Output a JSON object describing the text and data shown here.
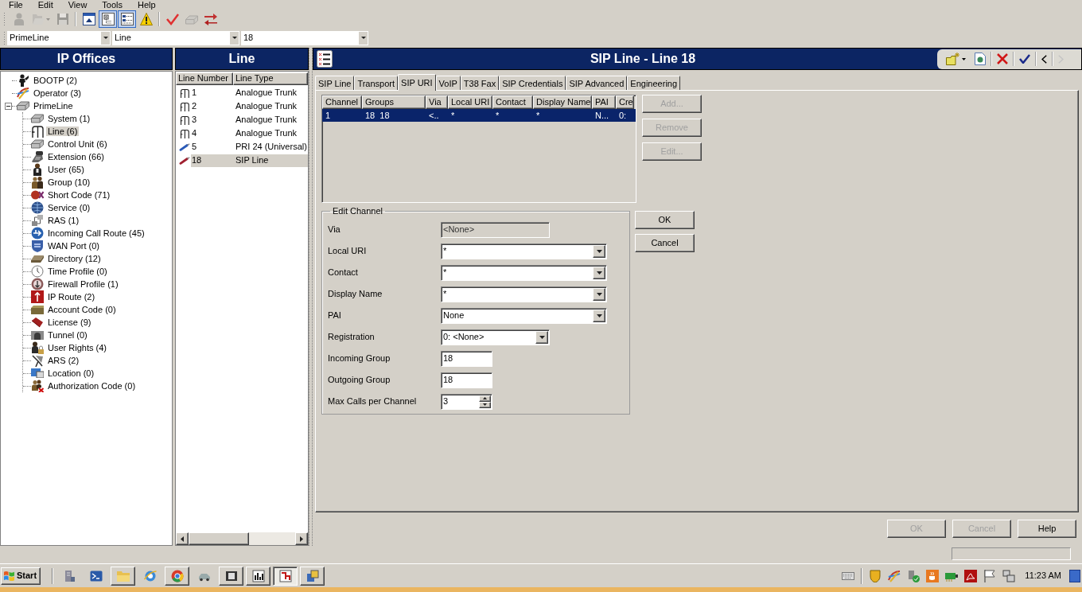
{
  "menu_bar": [
    {
      "label": "File"
    },
    {
      "label": "Edit"
    },
    {
      "label": "View"
    },
    {
      "label": "Tools"
    },
    {
      "label": "Help"
    }
  ],
  "toolbar": [
    {
      "kind": "user",
      "disabled": true,
      "pressed": false
    },
    {
      "kind": "open",
      "disabled": true,
      "pressed": false
    },
    {
      "kind": "save",
      "disabled": true,
      "pressed": false
    },
    {
      "kind": "separator"
    },
    {
      "kind": "collapse",
      "disabled": false,
      "pressed": false
    },
    {
      "kind": "tree",
      "disabled": false,
      "pressed": true
    },
    {
      "kind": "details",
      "disabled": false,
      "pressed": true
    },
    {
      "kind": "warning",
      "disabled": false,
      "pressed": false
    },
    {
      "kind": "separator"
    },
    {
      "kind": "validate",
      "disabled": false,
      "pressed": false
    },
    {
      "kind": "device",
      "disabled": true,
      "pressed": false
    },
    {
      "kind": "swap",
      "disabled": false,
      "pressed": false
    }
  ],
  "selectors": [
    {
      "value": "PrimeLine"
    },
    {
      "value": "Line"
    },
    {
      "value": "18"
    }
  ],
  "tree_panel": {
    "title": "IP Offices",
    "items": [
      {
        "label": "BOOTP (2)",
        "selected": false
      },
      {
        "label": "Operator (3)",
        "selected": false
      },
      {
        "label": "PrimeLine",
        "selected": false,
        "expanded": true,
        "children": [
          {
            "label": "System (1)",
            "selected": false
          },
          {
            "label": "Line (6)",
            "selected": true
          },
          {
            "label": "Control Unit (6)",
            "selected": false
          },
          {
            "label": "Extension (66)",
            "selected": false
          },
          {
            "label": "User (65)",
            "selected": false
          },
          {
            "label": "Group (10)",
            "selected": false
          },
          {
            "label": "Short Code (71)",
            "selected": false
          },
          {
            "label": "Service (0)",
            "selected": false
          },
          {
            "label": "RAS (1)",
            "selected": false
          },
          {
            "label": "Incoming Call Route (45)",
            "selected": false
          },
          {
            "label": "WAN Port (0)",
            "selected": false
          },
          {
            "label": "Directory (12)",
            "selected": false
          },
          {
            "label": "Time Profile (0)",
            "selected": false
          },
          {
            "label": "Firewall Profile (1)",
            "selected": false
          },
          {
            "label": "IP Route (2)",
            "selected": false
          },
          {
            "label": "Account Code (0)",
            "selected": false
          },
          {
            "label": "License (9)",
            "selected": false
          },
          {
            "label": "Tunnel (0)",
            "selected": false
          },
          {
            "label": "User Rights (4)",
            "selected": false
          },
          {
            "label": "ARS (2)",
            "selected": false
          },
          {
            "label": "Location (0)",
            "selected": false
          },
          {
            "label": "Authorization Code (0)",
            "selected": false
          }
        ]
      }
    ]
  },
  "line_panel": {
    "title": "Line",
    "columns": [
      "Line Number",
      "Line Type"
    ],
    "rows": [
      {
        "kind": "analogue",
        "number": "1",
        "type": "Analogue Trunk",
        "selected": false
      },
      {
        "kind": "analogue",
        "number": "2",
        "type": "Analogue Trunk",
        "selected": false
      },
      {
        "kind": "analogue",
        "number": "3",
        "type": "Analogue Trunk",
        "selected": false
      },
      {
        "kind": "analogue",
        "number": "4",
        "type": "Analogue Trunk",
        "selected": false
      },
      {
        "kind": "pri",
        "number": "5",
        "type": "PRI 24 (Universal)",
        "selected": false
      },
      {
        "kind": "sip",
        "number": "18",
        "type": "SIP Line",
        "selected": true
      }
    ]
  },
  "editor": {
    "title": "SIP Line - Line 18",
    "tools": [
      {
        "kind": "new",
        "disabled": false
      },
      {
        "kind": "export",
        "disabled": false
      },
      {
        "kind": "delete",
        "disabled": false
      },
      {
        "kind": "apply",
        "disabled": false
      },
      {
        "kind": "previous",
        "disabled": false
      },
      {
        "kind": "next",
        "disabled": true
      }
    ],
    "tabs": [
      {
        "label": "SIP Line",
        "selected": false
      },
      {
        "label": "Transport",
        "selected": false
      },
      {
        "label": "SIP URI",
        "selected": true
      },
      {
        "label": "VoIP",
        "selected": false
      },
      {
        "label": "T38 Fax",
        "selected": false
      },
      {
        "label": "SIP Credentials",
        "selected": false
      },
      {
        "label": "SIP Advanced",
        "selected": false
      },
      {
        "label": "Engineering",
        "selected": false
      }
    ],
    "channel_table": {
      "columns": [
        "Channel",
        "Groups",
        "Via",
        "Local URI",
        "Contact",
        "Display Name",
        "PAI",
        "Cre"
      ],
      "rows": [
        {
          "cells": [
            "1",
            "18  18",
            "<..",
            "*",
            "*",
            "*",
            "N...",
            "0:"
          ],
          "selected": true
        }
      ]
    },
    "table_buttons": [
      {
        "label": "Add...",
        "disabled": true
      },
      {
        "label": "Remove",
        "disabled": true
      },
      {
        "label": "Edit...",
        "disabled": true
      }
    ],
    "edit_channel": {
      "title": "Edit Channel",
      "fields": [
        {
          "label": "Via",
          "kind": "readonly",
          "value": "<None>"
        },
        {
          "label": "Local URI",
          "kind": "combo",
          "value": "*"
        },
        {
          "label": "Contact",
          "kind": "combo",
          "value": "*"
        },
        {
          "label": "Display Name",
          "kind": "combo",
          "value": "*"
        },
        {
          "label": "PAI",
          "kind": "combo",
          "value": "None"
        },
        {
          "label": "Registration",
          "kind": "shortcombo",
          "value": "0: <None>"
        },
        {
          "label": "Incoming Group",
          "kind": "text",
          "value": "18"
        },
        {
          "label": "Outgoing Group",
          "kind": "text",
          "value": "18"
        },
        {
          "label": "Max Calls per Channel",
          "kind": "spinner",
          "value": "3"
        }
      ]
    },
    "edit_buttons": [
      {
        "label": "OK",
        "disabled": false
      },
      {
        "label": "Cancel",
        "disabled": false
      }
    ],
    "footer_buttons": [
      {
        "label": "OK",
        "disabled": true
      },
      {
        "label": "Cancel",
        "disabled": true
      },
      {
        "label": "Help",
        "disabled": false
      }
    ]
  },
  "taskbar": {
    "start": "Start",
    "apps": [
      {
        "kind": "server",
        "running": false,
        "selected": false
      },
      {
        "kind": "terminal",
        "running": false,
        "selected": false
      },
      {
        "kind": "folder",
        "running": true,
        "selected": false
      },
      {
        "kind": "globe",
        "running": false,
        "selected": false
      },
      {
        "kind": "wheel",
        "running": true,
        "selected": false
      },
      {
        "kind": "car",
        "running": false,
        "selected": false
      },
      {
        "kind": "screen",
        "running": true,
        "selected": false
      },
      {
        "kind": "barchart",
        "running": true,
        "selected": false
      },
      {
        "kind": "stepchart",
        "running": true,
        "selected": true
      },
      {
        "kind": "tiles",
        "running": true,
        "selected": false
      }
    ],
    "clock": "11:23 AM"
  }
}
